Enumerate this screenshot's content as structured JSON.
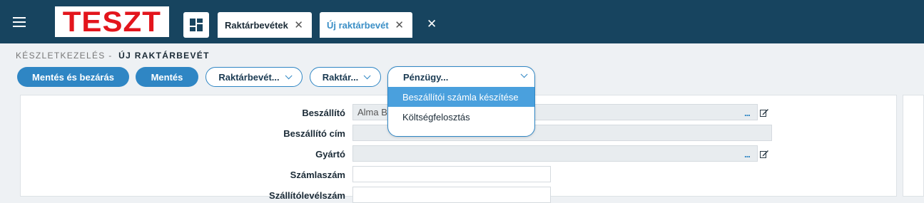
{
  "topbar": {
    "logo_text": "TESZT",
    "tabs": [
      {
        "label": "Raktárbevétek",
        "close": "✕"
      },
      {
        "label": "Új raktárbevét",
        "close": "✕"
      }
    ],
    "close_all": "✕"
  },
  "breadcrumb": {
    "parent": "KÉSZLETKEZELÉS -",
    "current": "ÚJ RAKTÁRBEVÉT"
  },
  "toolbar": {
    "save_close": "Mentés és bezárás",
    "save": "Mentés",
    "menu1": "Raktárbevét...",
    "menu2": "Raktár...",
    "menu3": "Pénzügy..."
  },
  "dropdown": {
    "items": [
      "Beszállítói számla készítése",
      "Költségfelosztás"
    ]
  },
  "form": {
    "supplier": {
      "label": "Beszállító",
      "value": "Alma B"
    },
    "supplier_address": {
      "label": "Beszállító cím",
      "value": ""
    },
    "manufacturer": {
      "label": "Gyártó",
      "value": ""
    },
    "invoice_number": {
      "label": "Számlaszám",
      "value": ""
    },
    "delivery_note": {
      "label": "Szállítólevélszám",
      "value": ""
    },
    "dots": "..."
  },
  "colors": {
    "topbar": "#17445f",
    "accent": "#2f86c4",
    "logo_red": "#e3151c",
    "highlight": "#4aa0dd"
  }
}
